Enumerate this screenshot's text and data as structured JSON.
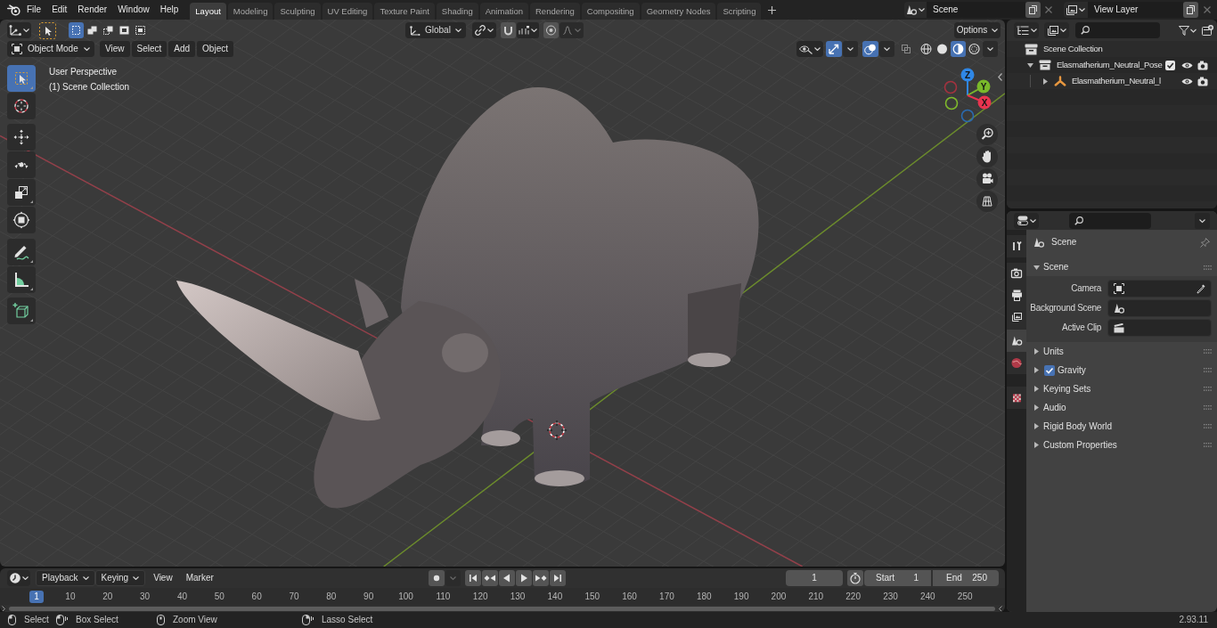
{
  "top_bar": {
    "menus": [
      {
        "label": "File"
      },
      {
        "label": "Edit"
      },
      {
        "label": "Render"
      },
      {
        "label": "Window"
      },
      {
        "label": "Help"
      }
    ],
    "workspace_tabs": [
      {
        "label": "Layout",
        "selected": true
      },
      {
        "label": "Modeling",
        "selected": false
      },
      {
        "label": "Sculpting",
        "selected": false
      },
      {
        "label": "UV Editing",
        "selected": false
      },
      {
        "label": "Texture Paint",
        "selected": false
      },
      {
        "label": "Shading",
        "selected": false
      },
      {
        "label": "Animation",
        "selected": false
      },
      {
        "label": "Rendering",
        "selected": false
      },
      {
        "label": "Compositing",
        "selected": false
      },
      {
        "label": "Geometry Nodes",
        "selected": false
      },
      {
        "label": "Scripting",
        "selected": false
      }
    ],
    "scene_selector": {
      "value": "Scene"
    },
    "view_layer_selector": {
      "value": "View Layer"
    }
  },
  "viewport": {
    "header": {
      "select_modes": [
        {
          "kind": "new",
          "selected": true
        },
        {
          "kind": "extend",
          "selected": false
        },
        {
          "kind": "subtract",
          "selected": false
        },
        {
          "kind": "difference",
          "selected": false
        },
        {
          "kind": "intersect",
          "selected": false
        }
      ],
      "transform_orientation": "Global",
      "options_label": "Options",
      "mode": "Object Mode",
      "menus": [
        "View",
        "Select",
        "Add",
        "Object"
      ],
      "gizmos": {
        "on": true
      },
      "overlays": {
        "on": true
      },
      "xray": {
        "on": false
      },
      "shading_modes": [
        {
          "kind": "wireframe",
          "selected": false
        },
        {
          "kind": "solid",
          "selected": false
        },
        {
          "kind": "material",
          "selected": true
        },
        {
          "kind": "rendered",
          "selected": false
        }
      ]
    },
    "tool_groups": [
      {
        "tools": [
          {
            "kind": "select_box",
            "selected": true
          },
          {
            "kind": "cursor",
            "selected": false
          }
        ]
      },
      {
        "tools": [
          {
            "kind": "move",
            "selected": false
          },
          {
            "kind": "rotate",
            "selected": false
          },
          {
            "kind": "scale",
            "selected": false
          },
          {
            "kind": "transform",
            "selected": false
          }
        ]
      },
      {
        "tools": [
          {
            "kind": "annotate",
            "selected": false
          },
          {
            "kind": "measure",
            "selected": false
          }
        ]
      },
      {
        "tools": [
          {
            "kind": "add_cube",
            "selected": false
          }
        ]
      }
    ],
    "info_text": [
      "User Perspective",
      "(1) Scene Collection"
    ],
    "navigation_gizmo": {
      "axes": [
        {
          "kind": "positive",
          "label": "Z",
          "color": "#2f87e6"
        },
        {
          "kind": "positive",
          "label": "Y",
          "color": "#79b92a"
        },
        {
          "kind": "positive",
          "label": "X",
          "color": "#e8344f"
        },
        {
          "kind": "negative",
          "color": "#a3323f"
        },
        {
          "kind": "negative",
          "color": "#7fb92c"
        },
        {
          "kind": "negative",
          "color": "#2a6ab0"
        }
      ]
    }
  },
  "outliner": {
    "tree": [
      {
        "kind": "scene_collection",
        "label": "Scene Collection",
        "children": [
          {
            "kind": "collection",
            "label": "Elasmatherium_Neutral_Pose",
            "expanded": true,
            "checked": true,
            "children": [
              {
                "kind": "armature",
                "label": "Elasmatherium_Neutral_l",
                "expanded": false
              }
            ]
          }
        ]
      }
    ]
  },
  "properties": {
    "tab_groups": [
      {
        "tabs": [
          {
            "kind": "tool",
            "selected": false
          }
        ]
      },
      {
        "tabs": [
          {
            "kind": "render",
            "selected": false
          },
          {
            "kind": "output",
            "selected": false
          },
          {
            "kind": "view_layer",
            "selected": false
          },
          {
            "kind": "scene",
            "selected": true
          },
          {
            "kind": "world",
            "selected": false
          }
        ]
      },
      {
        "tabs": [
          {
            "kind": "texture",
            "selected": false
          }
        ]
      }
    ],
    "context": "Scene",
    "panels": [
      {
        "label": "Scene",
        "expanded": true,
        "fields": [
          {
            "kind": "camera",
            "label": "Camera"
          },
          {
            "kind": "background_scene",
            "label": "Background Scene"
          },
          {
            "kind": "active_clip",
            "label": "Active Clip"
          }
        ]
      },
      {
        "label": "Units",
        "expanded": false
      },
      {
        "label": "Gravity",
        "expanded": false,
        "checkbox": {
          "checked": true
        }
      },
      {
        "label": "Keying Sets",
        "expanded": false
      },
      {
        "label": "Audio",
        "expanded": false
      },
      {
        "label": "Rigid Body World",
        "expanded": false
      },
      {
        "label": "Custom Properties",
        "expanded": false
      }
    ]
  },
  "timeline": {
    "menus": [
      {
        "kind": "dropdown",
        "label": "Playback"
      },
      {
        "kind": "dropdown",
        "label": "Keying"
      },
      {
        "kind": "menu",
        "label": "View"
      },
      {
        "kind": "menu",
        "label": "Marker"
      }
    ],
    "current_frame": "1",
    "start": {
      "label": "Start",
      "value": "1"
    },
    "end": {
      "label": "End",
      "value": "250"
    },
    "ruler": [
      {
        "label": "1",
        "selected": true
      },
      {
        "label": "10",
        "selected": false
      },
      {
        "label": "20",
        "selected": false
      },
      {
        "label": "30",
        "selected": false
      },
      {
        "label": "40",
        "selected": false
      },
      {
        "label": "50",
        "selected": false
      },
      {
        "label": "60",
        "selected": false
      },
      {
        "label": "70",
        "selected": false
      },
      {
        "label": "80",
        "selected": false
      },
      {
        "label": "90",
        "selected": false
      },
      {
        "label": "100",
        "selected": false
      },
      {
        "label": "110",
        "selected": false
      },
      {
        "label": "120",
        "selected": false
      },
      {
        "label": "130",
        "selected": false
      },
      {
        "label": "140",
        "selected": false
      },
      {
        "label": "150",
        "selected": false
      },
      {
        "label": "160",
        "selected": false
      },
      {
        "label": "170",
        "selected": false
      },
      {
        "label": "180",
        "selected": false
      },
      {
        "label": "190",
        "selected": false
      },
      {
        "label": "200",
        "selected": false
      },
      {
        "label": "210",
        "selected": false
      },
      {
        "label": "220",
        "selected": false
      },
      {
        "label": "230",
        "selected": false
      },
      {
        "label": "240",
        "selected": false
      },
      {
        "label": "250",
        "selected": false
      }
    ]
  },
  "status_bar": {
    "hints": [
      {
        "kind": "left_click",
        "label": "Select"
      },
      {
        "kind": "left_drag",
        "label": "Box Select"
      },
      {
        "kind": "middle_click",
        "label": "Zoom View"
      },
      {
        "kind": "right_drag",
        "label": "Lasso Select"
      }
    ],
    "version": "2.93.11"
  }
}
